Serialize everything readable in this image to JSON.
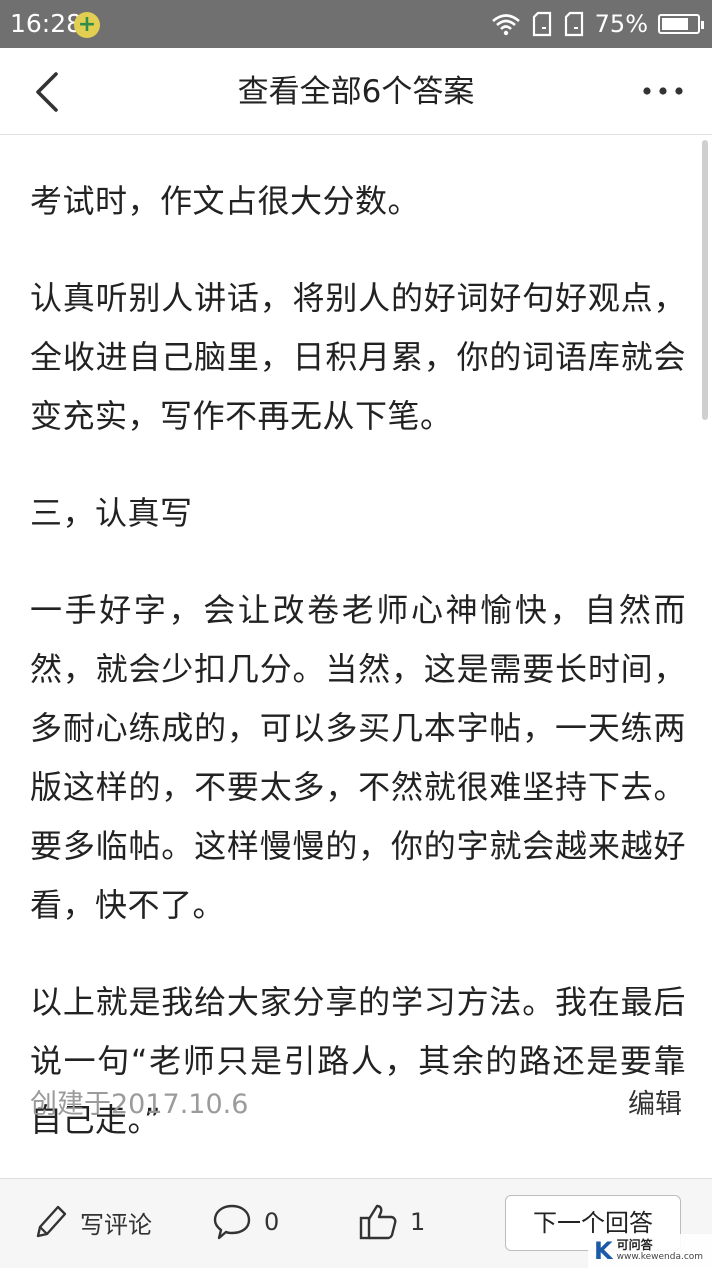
{
  "status_bar": {
    "time": "16:28",
    "battery": "75%",
    "battery_level": 0.75
  },
  "nav": {
    "title": "查看全部6个答案"
  },
  "answer": {
    "paragraphs": [
      "考试时，作文占很大分数。",
      "认真听别人讲话，将别人的好词好句好观点，全收进自己脑里，日积月累，你的词语库就会变充实，写作不再无从下笔。",
      "三，认真写",
      "一手好字，会让改卷老师心神愉快，自然而然，就会少扣几分。当然，这是需要长时间，多耐心练成的，可以多买几本字帖，一天练两版这样的，不要太多，不然就很难坚持下去。要多临帖。这样慢慢的，你的字就会越来越好看，快不了。",
      "以上就是我给大家分享的学习方法。我在最后说一句“老师只是引路人，其余的路还是要靠自己走。”"
    ],
    "created": "创建于2017.10.6",
    "edit_label": "编辑"
  },
  "toolbar": {
    "comment_label": "写评论",
    "comment_count": "0",
    "like_count": "1",
    "next_label": "下一个回答"
  },
  "watermark": {
    "logo": "K",
    "name": "可问答",
    "url": "www.kewenda.com"
  }
}
